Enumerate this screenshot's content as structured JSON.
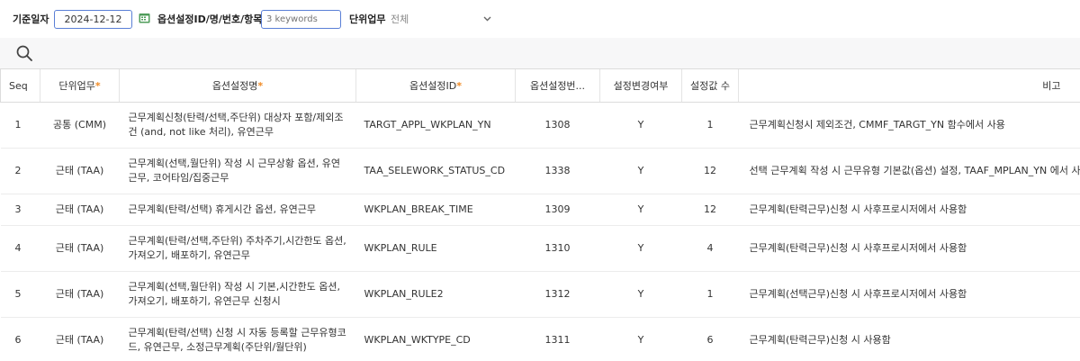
{
  "filters": {
    "base_date_label": "기준일자",
    "base_date_value": "2024-12-12",
    "option_label": "옵션설정ID/명/번호/항목",
    "keyword_placeholder": "3 keywords",
    "unit_label": "단위업무",
    "unit_value": "전체"
  },
  "table": {
    "headers": {
      "seq": "Seq",
      "unit": "단위업무",
      "name": "옵션설정명",
      "id": "옵션설정ID",
      "number": "옵션설정번...",
      "changed": "설정변경여부",
      "count": "설정값 수",
      "note": "비고"
    },
    "required_mark": "*",
    "rows": [
      {
        "seq": "1",
        "unit": "공통 (CMM)",
        "name": "근무계획신청(탄력/선택,주단위) 대상자 포함/제외조건 (and, not like 처리), 유연근무",
        "id": "TARGT_APPL_WKPLAN_YN",
        "number": "1308",
        "changed": "Y",
        "count": "1",
        "note": "근무계획신청시 제외조건, CMMF_TARGT_YN 함수에서 사용"
      },
      {
        "seq": "2",
        "unit": "근태 (TAA)",
        "name": "근무계획(선택,월단위) 작성 시 근무상황 옵션, 유연근무, 코어타임/집중근무",
        "id": "TAA_SELEWORK_STATUS_CD",
        "number": "1338",
        "changed": "Y",
        "count": "12",
        "note": "선택 근무계획 작성 시 근무유형 기본값(옵션) 설정, TAAF_MPLAN_YN 에서 사용"
      },
      {
        "seq": "3",
        "unit": "근태 (TAA)",
        "name": "근무계획(탄력/선택) 휴게시간 옵션, 유연근무",
        "id": "WKPLAN_BREAK_TIME",
        "number": "1309",
        "changed": "Y",
        "count": "12",
        "note": "근무계획(탄력근무)신청 시 사후프로시저에서 사용함"
      },
      {
        "seq": "4",
        "unit": "근태 (TAA)",
        "name": "근무계획(탄력/선택,주단위) 주차주기,시간한도 옵션, 가져오기, 배포하기, 유연근무",
        "id": "WKPLAN_RULE",
        "number": "1310",
        "changed": "Y",
        "count": "4",
        "note": "근무계획(탄력근무)신청 시 사후프로시저에서 사용함"
      },
      {
        "seq": "5",
        "unit": "근태 (TAA)",
        "name": "근무계획(선택,월단위) 작성 시 기본,시간한도 옵션, 가져오기, 배포하기, 유연근무 신청시",
        "id": "WKPLAN_RULE2",
        "number": "1312",
        "changed": "Y",
        "count": "1",
        "note": "근무계획(선택근무)신청 시 사후프로시저에서 사용함"
      },
      {
        "seq": "6",
        "unit": "근태 (TAA)",
        "name": "근무계획(탄력/선택) 신청 시 자동 등록할 근무유형코드, 유연근무, 소정근무계획(주단위/월단위)",
        "id": "WKPLAN_WKTYPE_CD",
        "number": "1311",
        "changed": "Y",
        "count": "6",
        "note": "근무계획(탄력근무)신청 시 사용함"
      }
    ]
  },
  "icons": {
    "calendar": "calendar-icon",
    "chevron": "chevron-down-icon",
    "search": "search-icon"
  },
  "colors": {
    "input_border": "#5a7fd6",
    "required": "#f08a24",
    "strip": "#f7f7f8"
  }
}
